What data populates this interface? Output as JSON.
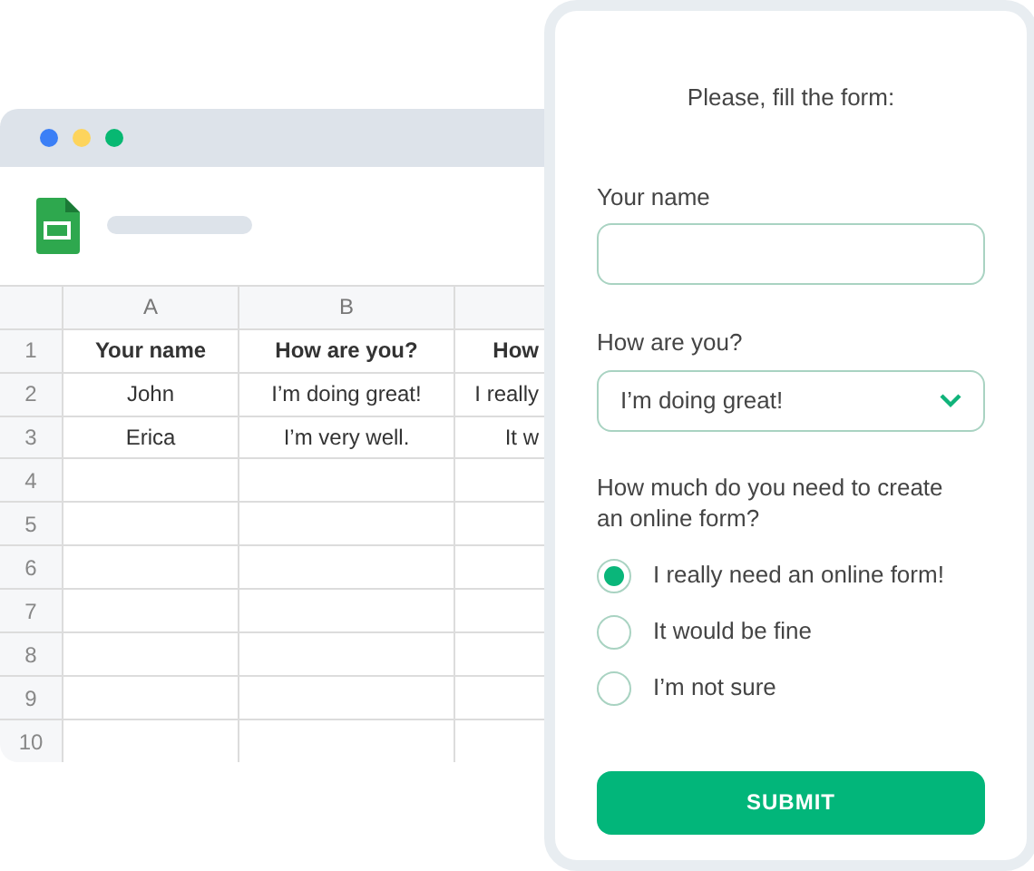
{
  "spreadsheet": {
    "columns": [
      "A",
      "B"
    ],
    "header_row": {
      "number": "1",
      "cells": [
        "Your name",
        "How are you?",
        "How"
      ]
    },
    "rows": [
      {
        "number": "2",
        "cells": [
          "John",
          "I’m doing great!",
          "I really"
        ]
      },
      {
        "number": "3",
        "cells": [
          "Erica",
          "I’m very well.",
          "It w"
        ]
      },
      {
        "number": "4"
      },
      {
        "number": "5"
      },
      {
        "number": "6"
      },
      {
        "number": "7"
      },
      {
        "number": "8"
      },
      {
        "number": "9"
      },
      {
        "number": "10"
      }
    ]
  },
  "form": {
    "title": "Please, fill the form:",
    "name_label": "Your name",
    "mood_label": "How are you?",
    "mood_value": "I’m doing great!",
    "question": "How much do you need to create an online form?",
    "options": [
      {
        "label": "I really need an online form!",
        "selected": true
      },
      {
        "label": "It would be fine",
        "selected": false
      },
      {
        "label": "I’m not sure",
        "selected": false
      }
    ],
    "submit": "SUBMIT"
  }
}
